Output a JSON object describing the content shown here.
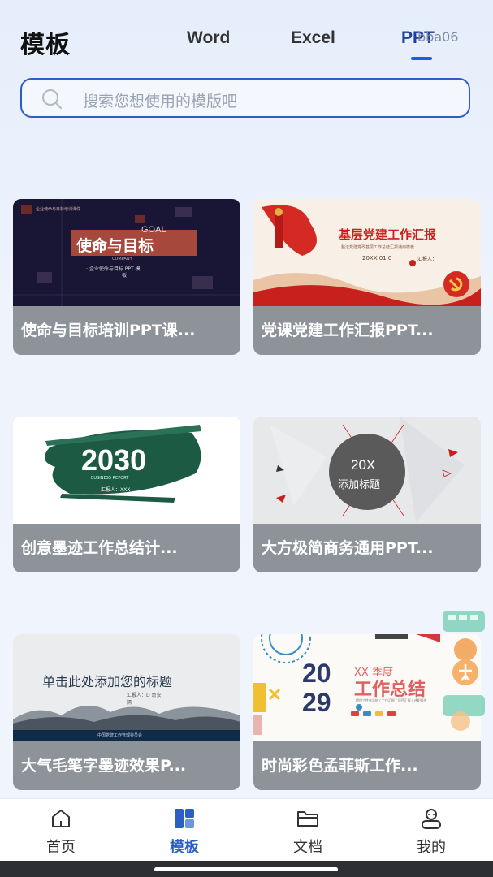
{
  "header": {
    "title": "模板",
    "tabs": [
      {
        "label": "Word"
      },
      {
        "label": "Excel"
      },
      {
        "label": "PPT"
      }
    ],
    "watermark": "bba06"
  },
  "search": {
    "placeholder": "搜索您想使用的模版吧"
  },
  "templates": [
    {
      "title": "使命与目标培训PPT课...",
      "thumb": {
        "eyebrow": "企业使命与目标培训课件",
        "heading": "使命与目标",
        "tag": "GOAL",
        "company": "COMPANY",
        "sub": "· 企业使命与目标 PPT 模",
        "sub2": "板"
      }
    },
    {
      "title": "党课党建工作汇报PPT...",
      "thumb": {
        "heading": "基层党建工作汇报",
        "sub": "整洁党建党政基层工作总结汇报通用模板",
        "date": "20XX.01.0",
        "reporter": "汇报人："
      }
    },
    {
      "title": "创意墨迹工作总结计...",
      "thumb": {
        "heading": "2030",
        "sub": "BUSINESS REPORT",
        "reporter": "汇报人：XXX"
      }
    },
    {
      "title": "大方极简商务通用PPT...",
      "thumb": {
        "year": "20X",
        "heading": "添加标题"
      }
    },
    {
      "title": "大气毛笔字墨迹效果P...",
      "thumb": {
        "heading": "单击此处添加您的标题",
        "reporter": "汇报人：D 意安",
        "reporter2": "隔",
        "footer": "中国党建工作管理委员会"
      }
    },
    {
      "title": "时尚彩色孟菲斯工作...",
      "thumb": {
        "season": "XX 季度",
        "year_top": "20",
        "year_bottom": "29",
        "heading": "工作总结",
        "sub": "提供个性化总结 / 工作汇报 / 项目汇报 / 述职报告"
      }
    }
  ],
  "bottom_nav": [
    {
      "label": "首页",
      "icon": "home-icon"
    },
    {
      "label": "模板",
      "icon": "template-icon"
    },
    {
      "label": "文档",
      "icon": "folder-icon"
    },
    {
      "label": "我的",
      "icon": "profile-icon"
    }
  ],
  "colors": {
    "accent": "#2b5fc4",
    "caption_bg": "#8e9299",
    "party_red": "#c8201d",
    "ink_green": "#1d5a44"
  }
}
